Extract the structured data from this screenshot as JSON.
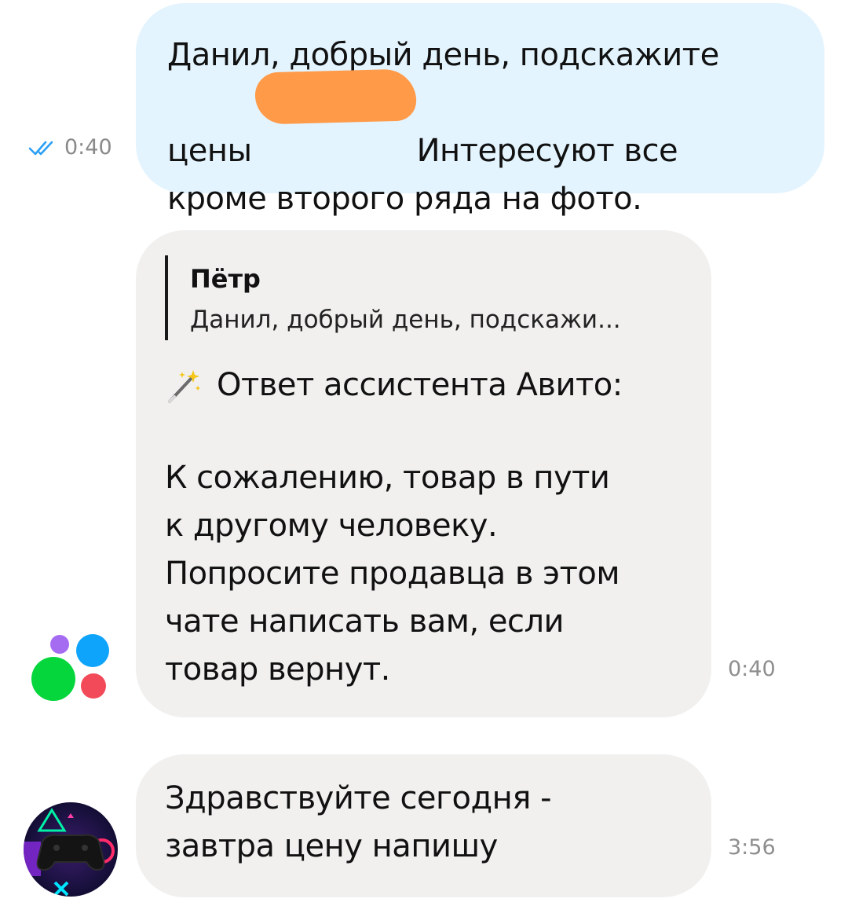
{
  "outgoing": {
    "lines": [
      "Данил, добрый день, подскажите",
      "цены",
      "Интересуют все",
      "кроме второго ряда на фото."
    ],
    "time": "0:40",
    "read_icon": "double-check-icon",
    "colors": {
      "bubble": "#e3f4fe",
      "check": "#2b9ff5",
      "redaction": "#ff9a49"
    }
  },
  "bot_message": {
    "quote_author": "Пётр",
    "quote_text": "Данил, добрый день, подскажи...",
    "assistant_icon": "magic-wand-icon",
    "assistant_label": "Ответ ассистента Авито:",
    "body": "К сожалению, товар в пути\nк другому человеку.\nПопросите продавца в этом\nчате написать вам, если\nтовар вернут.",
    "time": "0:40",
    "avatar": "avito-logo-icon",
    "colors": {
      "bubble": "#f1f0ef"
    }
  },
  "reply_message": {
    "body": "Здравствуйте сегодня -\nзавтра цену напишу",
    "time": "3:56",
    "avatar": "gamepad-avatar"
  }
}
